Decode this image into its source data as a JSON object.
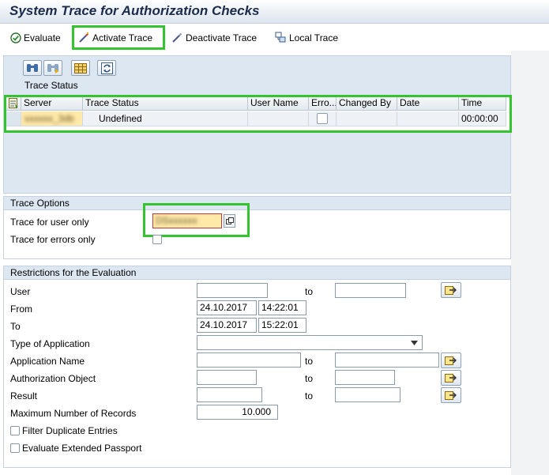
{
  "title": "System Trace for Authorization Checks",
  "toolbar": {
    "evaluate": "Evaluate",
    "activate": "Activate Trace",
    "deactivate": "Deactivate Trace",
    "local": "Local Trace"
  },
  "trace_status": {
    "title": "Trace Status",
    "columns": [
      "Server",
      "Trace Status",
      "User Name",
      "Erro...",
      "Changed By",
      "Date",
      "Time"
    ],
    "row": {
      "server": "xxxxxx_3db",
      "trace_status": "Undefined",
      "user_name": "",
      "error_checked": false,
      "changed_by": "",
      "date": "",
      "time": "00:00:00"
    }
  },
  "trace_options": {
    "title": "Trace Options",
    "user_only_label": "Trace for user only",
    "user_only_value": "DSxxxxxx",
    "errors_only_label": "Trace for errors only",
    "errors_only_checked": false
  },
  "restrictions": {
    "title": "Restrictions for the Evaluation",
    "to_label": "to",
    "user_label": "User",
    "from_label": "From",
    "from_date": "24.10.2017",
    "from_time": "14:22:01",
    "to_row_label": "To",
    "to_date": "24.10.2017",
    "to_time": "15:22:01",
    "type_app_label": "Type of Application",
    "app_name_label": "Application Name",
    "auth_obj_label": "Authorization Object",
    "result_label": "Result",
    "max_records_label": "Maximum Number of Records",
    "max_records_value": "10.000",
    "filter_dup_label": "Filter Duplicate Entries",
    "filter_dup_checked": false,
    "ext_passport_label": "Evaluate Extended Passport",
    "ext_passport_checked": false
  },
  "colors": {
    "highlight_outline": "#34c430",
    "panel_bg": "#dde7f1",
    "server_cell": "#ffe9a8"
  }
}
